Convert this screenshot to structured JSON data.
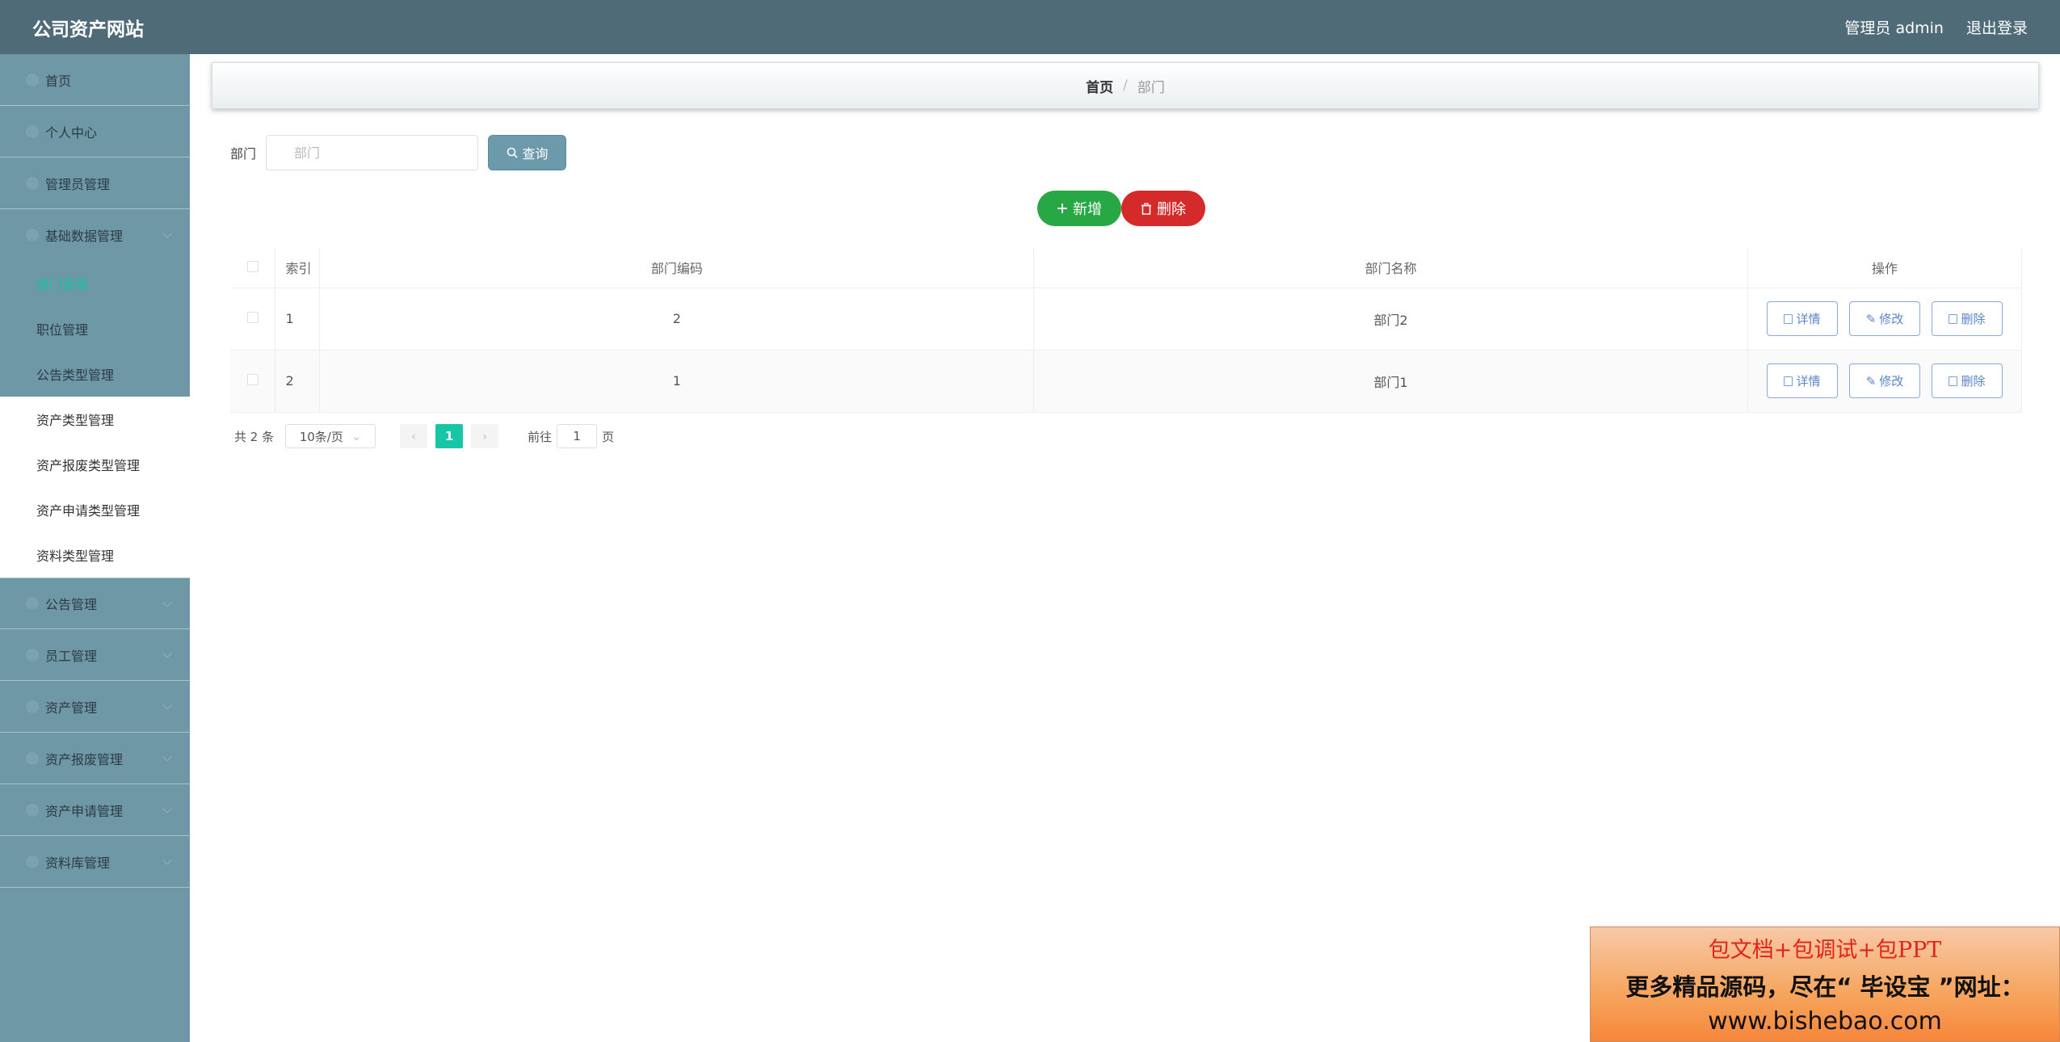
{
  "header": {
    "title": "公司资产网站",
    "user_label": "管理员 admin",
    "logout_label": "退出登录"
  },
  "sidebar": {
    "items": [
      {
        "label": "首页"
      },
      {
        "label": "个人中心"
      },
      {
        "label": "管理员管理"
      },
      {
        "label": "基础数据管理"
      }
    ],
    "submenu": [
      {
        "label": "部门管理"
      },
      {
        "label": "职位管理"
      },
      {
        "label": "公告类型管理"
      },
      {
        "label": "资产类型管理"
      },
      {
        "label": "资产报废类型管理"
      },
      {
        "label": "资产申请类型管理"
      },
      {
        "label": "资料类型管理"
      }
    ],
    "items_after": [
      {
        "label": "公告管理"
      },
      {
        "label": "员工管理"
      },
      {
        "label": "资产管理"
      },
      {
        "label": "资产报废管理"
      },
      {
        "label": "资产申请管理"
      },
      {
        "label": "资料库管理"
      }
    ]
  },
  "breadcrumb": {
    "home": "首页",
    "separator": "/",
    "current": "部门"
  },
  "search": {
    "label": "部门",
    "placeholder": "部门",
    "button_label": "查询"
  },
  "actions": {
    "add_label": "新增",
    "delete_label": "删除"
  },
  "table": {
    "columns": [
      "索引",
      "部门编码",
      "部门名称",
      "操作"
    ],
    "rows": [
      {
        "index": "1",
        "code": "2",
        "name": "部门2"
      },
      {
        "index": "2",
        "code": "1",
        "name": "部门1"
      }
    ],
    "row_actions": {
      "detail": "详情",
      "edit": "修改",
      "delete": "删除"
    }
  },
  "pagination": {
    "total": "共 2 条",
    "page_size": "10条/页",
    "current_page": "1",
    "goto_label": "前往",
    "goto_value": "1",
    "page_suffix": "页"
  },
  "ad": {
    "line1": "包文档+包调试+包PPT",
    "line2": "更多精品源码，尽在“ 毕设宝 ”网址：",
    "line3": "www.bishebao.com"
  },
  "colors": {
    "header_bg": "#506b78",
    "sidebar_bg": "#6f98a6",
    "accent": "#17c6a4",
    "add_button": "#28a745",
    "delete_button": "#d42a2a"
  }
}
